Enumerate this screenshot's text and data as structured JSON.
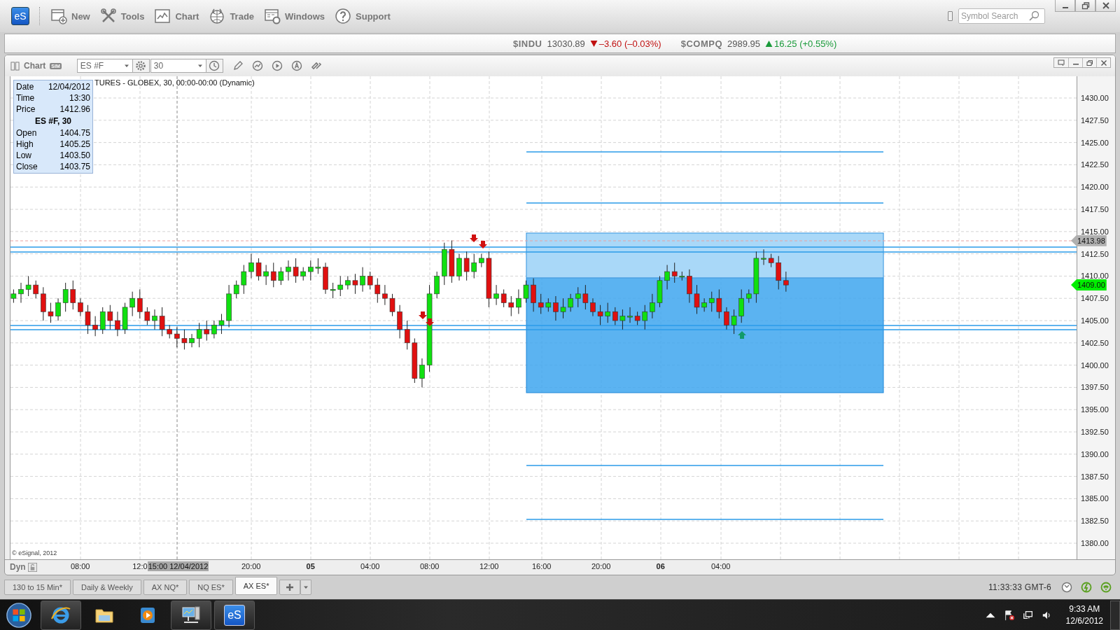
{
  "app_logo": "eS",
  "toolbar": {
    "items": [
      {
        "label": "New"
      },
      {
        "label": "Tools"
      },
      {
        "label": "Chart"
      },
      {
        "label": "Trade"
      },
      {
        "label": "Windows"
      },
      {
        "label": "Support"
      }
    ]
  },
  "search": {
    "placeholder": "Symbol Search"
  },
  "tickers": [
    {
      "symbol": "$INDU",
      "price": "13030.89",
      "change": "–3.60 (–0.03%)",
      "kind": "down"
    },
    {
      "symbol": "$COMPQ",
      "price": "2989.95",
      "change": "16.25 (+0.55%)",
      "kind": "up"
    }
  ],
  "chart_window": {
    "title": "Chart",
    "badge": "SIM",
    "symbol": "ES #F",
    "interval": "30",
    "study_title": "TURES - GLOBEX, 30, 00:00-00:00 (Dynamic)",
    "data_window": {
      "rows_top": [
        {
          "label": "Date",
          "value": "12/04/2012"
        },
        {
          "label": "Time",
          "value": "13:30"
        },
        {
          "label": "Price",
          "value": "1412.96"
        }
      ],
      "heading": "ES #F, 30",
      "rows_bottom": [
        {
          "label": "Open",
          "value": "1404.75"
        },
        {
          "label": "High",
          "value": "1405.25"
        },
        {
          "label": "Low",
          "value": "1403.50"
        },
        {
          "label": "Close",
          "value": "1403.75"
        }
      ]
    },
    "y_labels": [
      "1430.00",
      "1427.50",
      "1425.00",
      "1422.50",
      "1420.00",
      "1417.50",
      "1415.00",
      "1412.50",
      "1410.00",
      "1407.50",
      "1405.00",
      "1402.50",
      "1400.00",
      "1397.50",
      "1395.00",
      "1392.50",
      "1390.00",
      "1387.50",
      "1385.00",
      "1382.50",
      "1380.00"
    ],
    "price_flags": [
      {
        "text": "1413.98",
        "kind": "last"
      },
      {
        "text": "1409.00",
        "kind": "current"
      }
    ],
    "copyright": "© eSignal, 2012",
    "x_axis": {
      "prefix": "Dyn",
      "cursor_label": "15:00 12/04/2012",
      "labels": [
        {
          "text": "08:00",
          "bold": false
        },
        {
          "text": "12:0",
          "bold": false
        },
        {
          "text": "20:00",
          "bold": false
        },
        {
          "text": "05",
          "bold": true
        },
        {
          "text": "04:00",
          "bold": false
        },
        {
          "text": "08:00",
          "bold": false
        },
        {
          "text": "12:00",
          "bold": false
        },
        {
          "text": "16:00",
          "bold": false
        },
        {
          "text": "20:00",
          "bold": false
        },
        {
          "text": "06",
          "bold": true
        },
        {
          "text": "04:00",
          "bold": false
        }
      ]
    }
  },
  "tabs": [
    {
      "label": "130 to 15 Min*",
      "selected": false
    },
    {
      "label": "Daily & Weekly",
      "selected": false
    },
    {
      "label": "AX NQ*",
      "selected": false
    },
    {
      "label": "NQ ES*",
      "selected": false
    },
    {
      "label": "AX ES*",
      "selected": true
    }
  ],
  "status": {
    "time": "11:33:33 GMT-6"
  },
  "taskbar": {
    "logo": "eS",
    "time": "9:33 AM",
    "date": "12/6/2012"
  }
}
